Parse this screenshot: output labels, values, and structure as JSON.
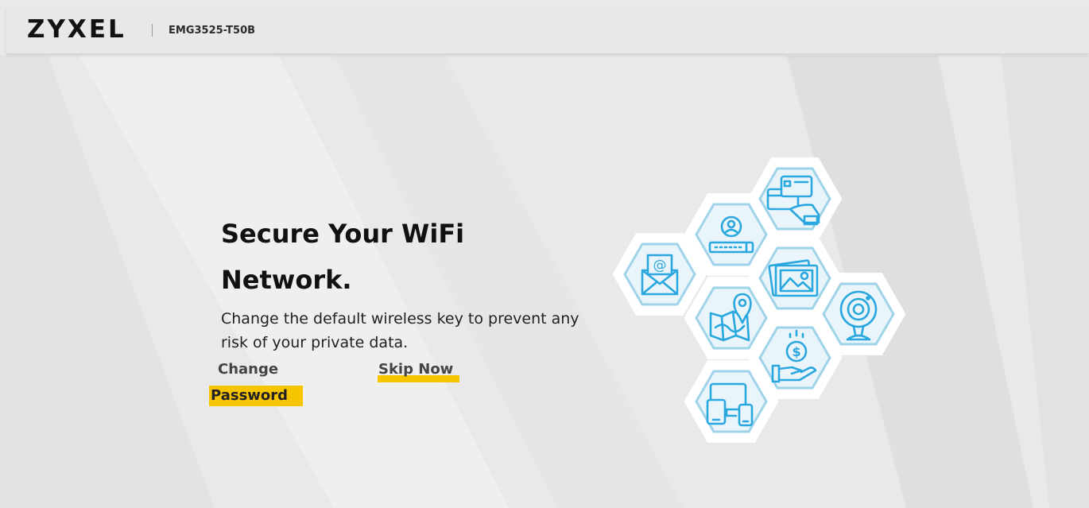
{
  "header": {
    "brand": "ZYXEL",
    "model": "EMG3525-T50B"
  },
  "hero": {
    "title_line1": "Secure Your WiFi",
    "title_line2": "Network.",
    "description_line1": "Change the default wireless key to prevent any",
    "description_line2": "risk of your private data."
  },
  "actions": {
    "change_password_line1": "Change",
    "change_password_line2": "Password",
    "skip_now": "Skip Now"
  },
  "illustration": {
    "icons": [
      "credit-card-icon",
      "user-login-icon",
      "email-icon",
      "photo-gallery-icon",
      "map-location-icon",
      "webcam-icon",
      "money-hand-icon",
      "devices-icon"
    ]
  },
  "colors": {
    "accent": "#f7c400",
    "icon_blue": "#2aa7de",
    "hex_outline": "#9fd3ea",
    "background": "#e9e9e9"
  }
}
